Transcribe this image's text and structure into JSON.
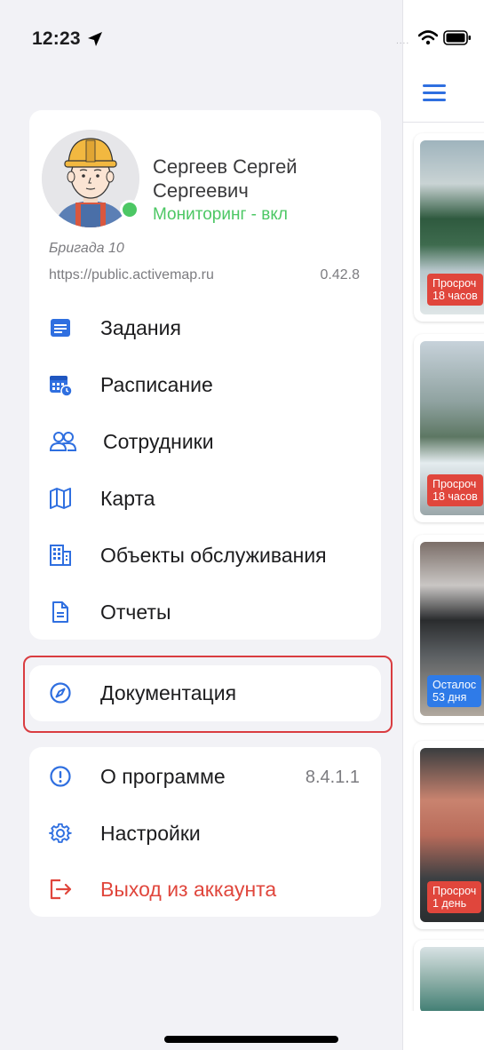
{
  "status_bar": {
    "time": "12:23",
    "location_icon": "location-arrow-icon",
    "dots": "....",
    "wifi_icon": "wifi-icon",
    "battery_icon": "battery-icon"
  },
  "profile": {
    "name": "Сергеев Сергей Сергеевич",
    "monitoring": "Мониторинг - вкл",
    "brigade": "Бригада 10",
    "server_url": "https://public.activemap.ru",
    "server_version": "0.42.8",
    "status_color": "#4cc764"
  },
  "menu": {
    "items": [
      {
        "label": "Задания",
        "icon": "tasks-icon"
      },
      {
        "label": "Расписание",
        "icon": "calendar-clock-icon"
      },
      {
        "label": "Сотрудники",
        "icon": "people-icon"
      },
      {
        "label": "Карта",
        "icon": "map-icon"
      },
      {
        "label": "Объекты обслуживания",
        "icon": "buildings-icon"
      },
      {
        "label": "Отчеты",
        "icon": "report-document-icon"
      }
    ]
  },
  "documentation": {
    "label": "Документация",
    "icon": "compass-icon"
  },
  "settings_menu": {
    "about": {
      "label": "О программе",
      "value": "8.4.1.1",
      "icon": "info-icon"
    },
    "settings": {
      "label": "Настройки",
      "icon": "gear-icon"
    },
    "logout": {
      "label": "Выход из аккаунта",
      "icon": "logout-icon",
      "color": "#e0463c"
    }
  },
  "background_list": {
    "cards": [
      {
        "badge": "Просроч\n18 часов",
        "badge_color": "#e0463c"
      },
      {
        "badge": "Просроч\n18 часов",
        "badge_color": "#e0463c"
      },
      {
        "badge": "Осталос\n53 дня",
        "badge_color": "#2f7be8"
      },
      {
        "badge": "Просроч\n1 день",
        "badge_color": "#e0463c"
      }
    ]
  },
  "colors": {
    "accent": "#2f6fe0",
    "danger": "#e0463c",
    "highlight_border": "#d93c40"
  }
}
